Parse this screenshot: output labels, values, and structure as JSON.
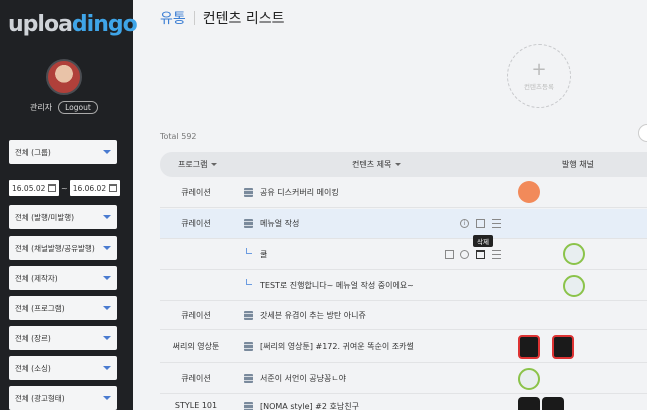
{
  "sidebar": {
    "logo_part1": "uploa",
    "logo_part2": "dingo",
    "user_name": "관리자",
    "logout_label": "Logout",
    "filters": {
      "group": "전체 (그룹)",
      "date_from": "16.05.02",
      "date_to": "16.06.02",
      "publish_status": "전체 (발행/미발행)",
      "channel_share": "전체 (채널발행/공유발행)",
      "author": "전체 (제작자)",
      "program": "전체 (프로그램)",
      "genre": "전체 (장르)",
      "source": "전체 (소싱)",
      "ad_type": "전체 (광고형태)"
    }
  },
  "header": {
    "breadcrumb_parent": "유통",
    "page_title": "컨텐츠 리스트"
  },
  "add_content_label": "컨텐츠등록",
  "total_label": "Total 592",
  "table": {
    "col_program": "프로그램",
    "col_title": "컨텐츠 제목",
    "col_channel": "발행 채널",
    "tooltip": "삭제",
    "rows": [
      {
        "program": "큐레이션",
        "title": "공유 디스커버리 메이킹"
      },
      {
        "program": "큐레이션",
        "title": "메뉴얼 작성"
      },
      {
        "program": "",
        "title": "쿨"
      },
      {
        "program": "",
        "title": "TEST로 진행합니다~ 메뉴얼 작성 중이에요~"
      },
      {
        "program": "큐레이션",
        "title": "갓세븐 유겸이 추는 방탄 아니쥬"
      },
      {
        "program": "써리의 영상툰",
        "title": "[써리의 영상툰] #172. 귀여운 똑순이 조카썰"
      },
      {
        "program": "큐레이션",
        "title": "서준이 서언이 공냥꽁ㄴ야"
      },
      {
        "program": "STYLE 101",
        "title": "[NOMA style] #2 호남친구"
      }
    ]
  },
  "colors": {
    "sidebar_bg": "#1f2124",
    "accent": "#3d7fd4",
    "row_highlight": "#e6eef8"
  }
}
